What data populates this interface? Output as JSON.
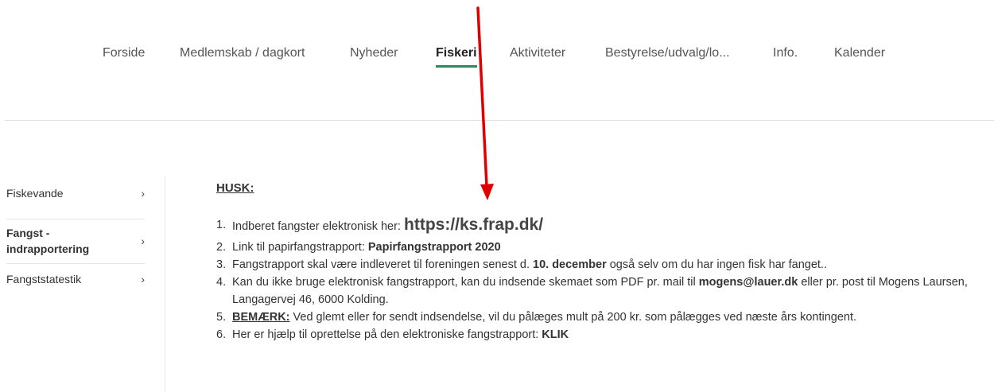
{
  "nav": {
    "items": [
      "Forside",
      "Medlemskab / dagkort",
      "Nyheder",
      "Fiskeri",
      "Aktiviteter",
      "Bestyrelse/udvalg/lo...",
      "Info.",
      "Kalender"
    ],
    "active": "Fiskeri"
  },
  "sidebar": {
    "items": [
      {
        "label": "Fiskevande"
      },
      {
        "label": "Fangst -",
        "label2": "indrapportering",
        "active": true
      },
      {
        "label": "Fangststatestik"
      }
    ],
    "chevron": "›"
  },
  "content": {
    "heading": "HUSK:",
    "items": [
      {
        "num": "1.",
        "text": "Indberet fangster elektronisk her: ",
        "link": "https://ks.frap.dk/"
      },
      {
        "num": "2.",
        "text": "Link til papirfangstrapport: ",
        "link": "Papirfangstrapport 2020"
      },
      {
        "num": "3.",
        "text_a": "Fangstrapport skal  være indleveret til foreningen senest d. ",
        "bold": "10. december",
        "text_b": " også selv om du har ingen fisk har fanget.."
      },
      {
        "num": "4.",
        "text_a": "Kan du ikke bruge elektronisk fangstrapport, kan du indsende skemaet som PDF pr. mail til ",
        "link": "mogens@lauer.dk",
        "text_b": " eller pr. post til Mogens Laursen, Langagervej 46, 6000 Kolding."
      },
      {
        "num": "5.",
        "label": "BEMÆRK:",
        "text": " Ved glemt eller for sendt indsendelse, vil du pålæges mult på 200 kr. som pålægges ved næste års kontingent."
      },
      {
        "num": "6.",
        "text": "Her er hjælp til oprettelse på den elektroniske fangstrapport: ",
        "link": "KLIK"
      }
    ]
  },
  "colors": {
    "accent": "#2a8a5a",
    "arrow": "#e00000",
    "text": "#333333"
  },
  "icons": {
    "chevron": "chevron-right-icon",
    "arrow": "red-arrow-down-icon"
  }
}
